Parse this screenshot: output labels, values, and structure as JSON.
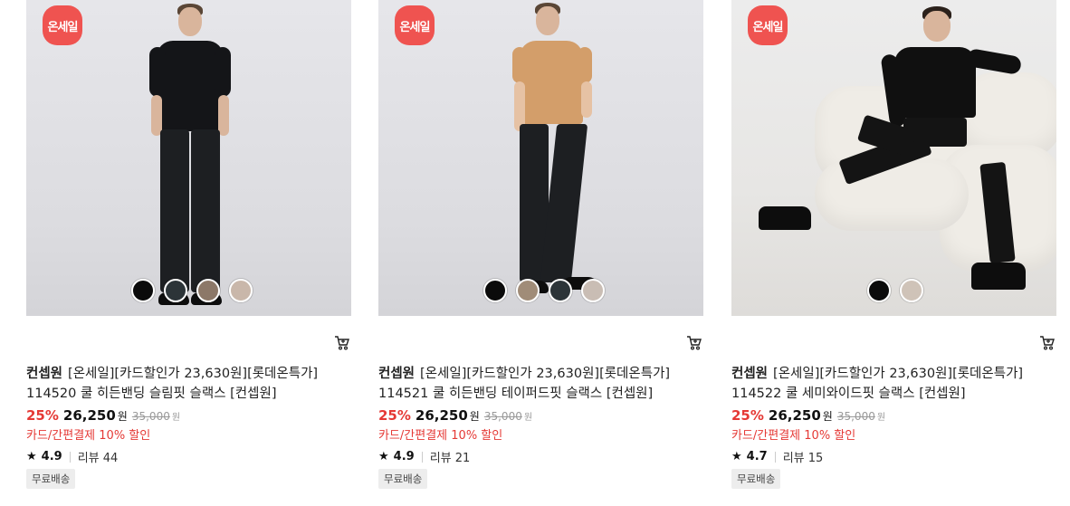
{
  "products": [
    {
      "badge": "온세일",
      "brand": "컨셉원",
      "title_line1": "[온세일][카드할인가 23,630원][롯데온특가]",
      "title_line2": "114520 쿨 히든밴딩 슬림핏 슬랙스 [컨셉원]",
      "discount": "25%",
      "price": "26,250",
      "price_unit": "원",
      "original_price": "35,000",
      "original_unit": "원",
      "card_discount": "카드/간편결제 10% 할인",
      "rating": "4.9",
      "review_label": "리뷰 44",
      "shipping_tag": "무료배송",
      "swatches": [
        "#0b0b0b",
        "#2c3438",
        "#8c7868",
        "#c9b7aa"
      ],
      "top_color": "#141518"
    },
    {
      "badge": "온세일",
      "brand": "컨셉원",
      "title_line1": "[온세일][카드할인가 23,630원][롯데온특가]",
      "title_line2": "114521 쿨 히든밴딩 테이퍼드핏 슬랙스 [컨셉원]",
      "discount": "25%",
      "price": "26,250",
      "price_unit": "원",
      "original_price": "35,000",
      "original_unit": "원",
      "card_discount": "카드/간편결제 10% 할인",
      "rating": "4.9",
      "review_label": "리뷰 21",
      "shipping_tag": "무료배송",
      "swatches": [
        "#0b0b0b",
        "#a08c78",
        "#2c3438",
        "#c9bdb4"
      ],
      "top_color": "#d39e6a"
    },
    {
      "badge": "온세일",
      "brand": "컨셉원",
      "title_line1": "[온세일][카드할인가 23,630원][롯데온특가]",
      "title_line2": "114522 쿨 세미와이드핏 슬랙스 [컨셉원]",
      "discount": "25%",
      "price": "26,250",
      "price_unit": "원",
      "original_price": "35,000",
      "original_unit": "원",
      "card_discount": "카드/간편결제 10% 할인",
      "rating": "4.7",
      "review_label": "리뷰 15",
      "shipping_tag": "무료배송",
      "swatches": [
        "#0b0b0b",
        "#cfc3b8"
      ],
      "top_color": "#101010"
    }
  ],
  "colors": {
    "accent_red": "#e53935",
    "badge_red": "#ef5350"
  },
  "icons": {
    "cart": "cart-icon",
    "star": "star-icon"
  }
}
